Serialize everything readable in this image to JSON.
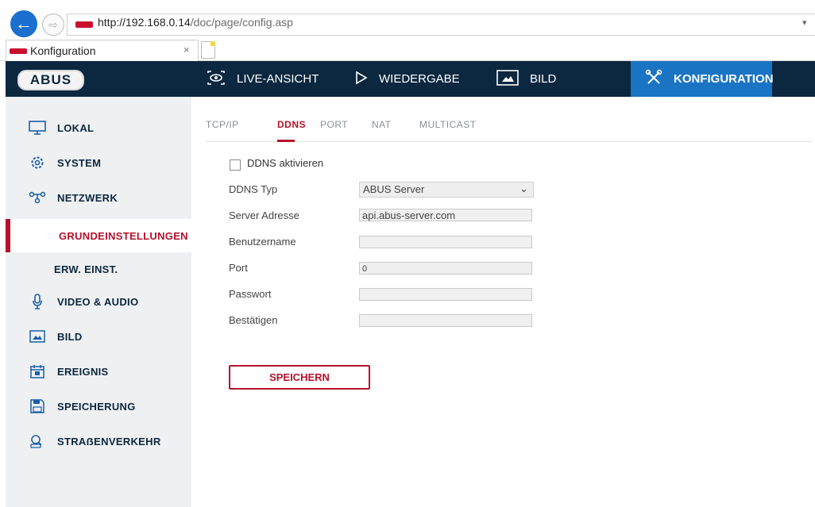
{
  "browser": {
    "url_host": "http://192.168.0.14",
    "url_path": "/doc/page/config.asp",
    "tab_title": "Konfiguration",
    "tab_close": "×"
  },
  "header": {
    "logo": "ABUS",
    "nav": [
      {
        "label": "LIVE-ANSICHT",
        "icon": "eye-icon"
      },
      {
        "label": "WIEDERGABE",
        "icon": "play-icon"
      },
      {
        "label": "BILD",
        "icon": "image-icon"
      },
      {
        "label": "KONFIGURATION",
        "icon": "tools-icon",
        "active": true
      }
    ]
  },
  "sidebar": {
    "items": [
      {
        "label": "LOKAL",
        "icon": "monitor-icon"
      },
      {
        "label": "SYSTEM",
        "icon": "gear-icon"
      },
      {
        "label": "NETZWERK",
        "icon": "network-icon"
      },
      {
        "label": "GRUNDEINSTELLUNGEN",
        "sub": true,
        "active": true
      },
      {
        "label": "ERW. EINST.",
        "sub": true
      },
      {
        "label": "VIDEO & AUDIO",
        "icon": "microphone-icon"
      },
      {
        "label": "BILD",
        "icon": "image-icon"
      },
      {
        "label": "EREIGNIS",
        "icon": "calendar-icon"
      },
      {
        "label": "SPEICHERUNG",
        "icon": "save-icon"
      },
      {
        "label": "STRAẞENVERKEHR",
        "icon": "car-search-icon"
      }
    ]
  },
  "content": {
    "tabs": [
      {
        "label": "TCP/IP"
      },
      {
        "label": "DDNS",
        "active": true
      },
      {
        "label": "PORT"
      },
      {
        "label": "NAT"
      },
      {
        "label": "MULTICAST"
      }
    ],
    "form": {
      "enable_label": "DDNS aktivieren",
      "enable_checked": false,
      "type_label": "DDNS Typ",
      "type_value": "ABUS Server",
      "server_label": "Server Adresse",
      "server_value": "api.abus-server.com",
      "user_label": "Benutzername",
      "user_value": "",
      "port_label": "Port",
      "port_value": "0",
      "password_label": "Passwort",
      "password_value": "",
      "confirm_label": "Bestätigen",
      "confirm_value": ""
    },
    "save_label": "SPEICHERN"
  },
  "colors": {
    "header_bg": "#0c2740",
    "nav_active": "#1a74c4",
    "accent_red": "#b5122b",
    "sidebar_bg": "#eef0f2"
  }
}
